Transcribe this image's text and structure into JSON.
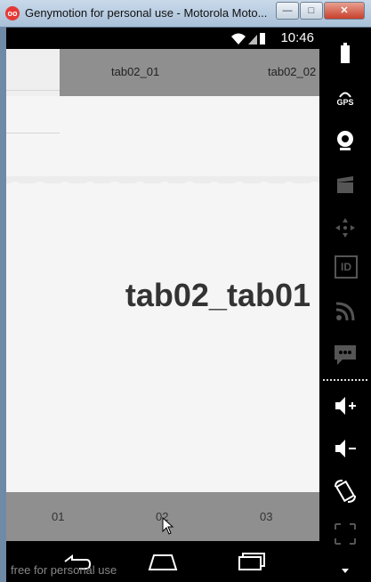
{
  "window": {
    "title": "Genymotion for personal use - Motorola Moto...",
    "app_icon_text": "oo",
    "minimize": "—",
    "maximize": "□",
    "close": "✕"
  },
  "status_bar": {
    "time": "10:46",
    "icons": [
      "wifi-icon",
      "signal-icon",
      "battery-icon"
    ]
  },
  "top_tabs": {
    "items": [
      {
        "label": "tab02_01"
      },
      {
        "label": "tab02_02"
      }
    ]
  },
  "content": {
    "title": "tab02_tab01"
  },
  "bottom_tabs": {
    "items": [
      {
        "label": "01"
      },
      {
        "label": "02"
      },
      {
        "label": "03"
      }
    ]
  },
  "nav": {
    "watermark": "free for personal use",
    "buttons": [
      "back-icon",
      "home-icon",
      "recents-icon"
    ]
  },
  "side_panel": {
    "gps_label": "GPS",
    "id_label": "ID",
    "icons": [
      "battery-icon",
      "gps-icon",
      "camera-icon",
      "video-icon",
      "dpad-icon",
      "id-icon",
      "rss-icon",
      "sms-icon",
      "volume-up-icon",
      "volume-down-icon",
      "rotate-icon",
      "scale-icon",
      "menu-arrow-icon"
    ]
  },
  "colors": {
    "tab_bar": "#8f8f8f",
    "screen_bg": "#f5f5f5",
    "panel_bg": "#000000",
    "title_text": "#333333"
  }
}
